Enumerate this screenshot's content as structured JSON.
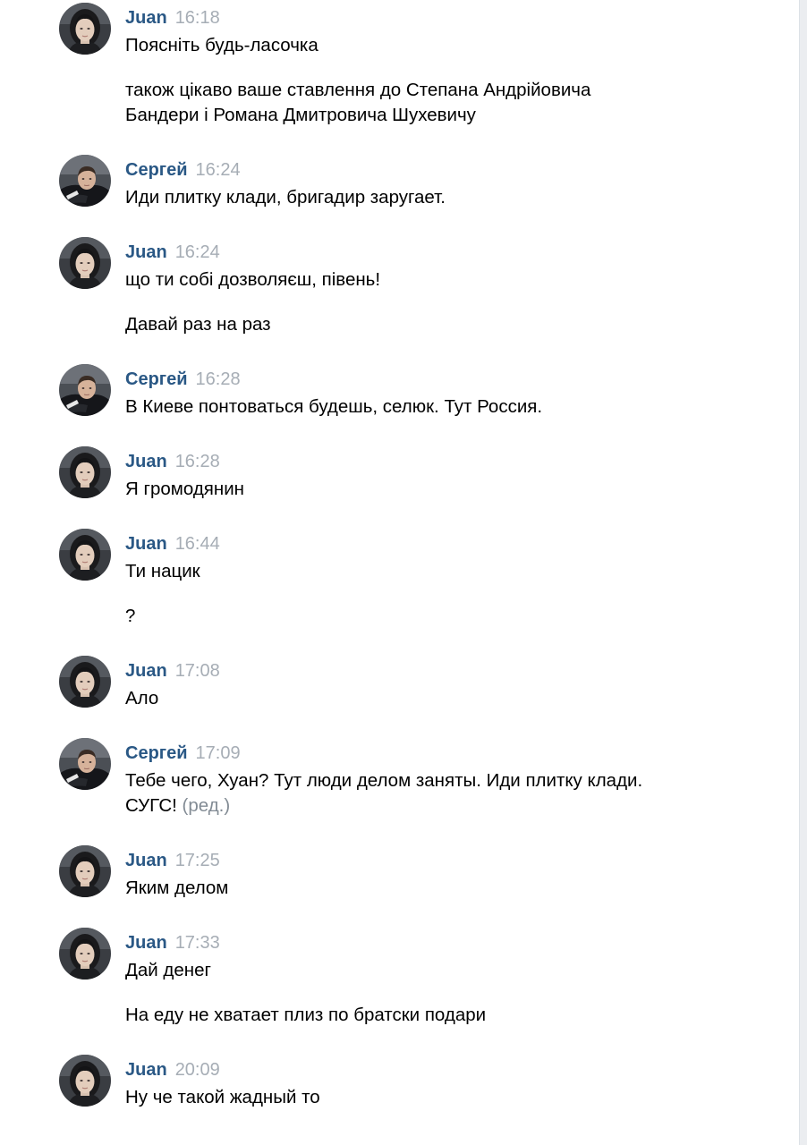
{
  "messages": [
    {
      "author": "Juan",
      "time": "16:18",
      "avatar": "juan",
      "lines": [
        "Поясніть будь-ласочка",
        "",
        "також цікаво ваше ставлення до Степана Андрійовича",
        "Бандери і Романа Дмитровича Шухевичу"
      ]
    },
    {
      "author": "Сергей",
      "time": "16:24",
      "avatar": "sergey",
      "lines": [
        "Иди плитку клади, бригадир заругает."
      ]
    },
    {
      "author": "Juan",
      "time": "16:24",
      "avatar": "juan",
      "lines": [
        "що ти собі дозволяєш, півень!",
        "",
        "Давай раз на раз"
      ]
    },
    {
      "author": "Сергей",
      "time": "16:28",
      "avatar": "sergey",
      "lines": [
        "В Киеве понтоваться будешь, селюк. Тут Россия."
      ]
    },
    {
      "author": "Juan",
      "time": "16:28",
      "avatar": "juan",
      "lines": [
        "Я громодянин"
      ]
    },
    {
      "author": "Juan",
      "time": "16:44",
      "avatar": "juan",
      "lines": [
        "Ти нацик",
        "",
        "?"
      ]
    },
    {
      "author": "Juan",
      "time": "17:08",
      "avatar": "juan",
      "lines": [
        "Ало"
      ]
    },
    {
      "author": "Сергей",
      "time": "17:09",
      "avatar": "sergey",
      "lines": [
        "Тебе чего, Хуан? Тут люди делом заняты. Иди плитку клади.",
        "СУГС!"
      ],
      "edited": "(ред.)"
    },
    {
      "author": "Juan",
      "time": "17:25",
      "avatar": "juan",
      "lines": [
        "Яким делом"
      ]
    },
    {
      "author": "Juan",
      "time": "17:33",
      "avatar": "juan",
      "lines": [
        "Дай денег",
        "",
        "На еду не хватает плиз по братски подари"
      ]
    },
    {
      "author": "Juan",
      "time": "20:09",
      "avatar": "juan",
      "lines": [
        "Ну че такой жадный то"
      ]
    }
  ],
  "colors": {
    "author": "#2a5885",
    "time": "#a6adb5",
    "edited": "#828b94",
    "background": "#ffffff"
  }
}
